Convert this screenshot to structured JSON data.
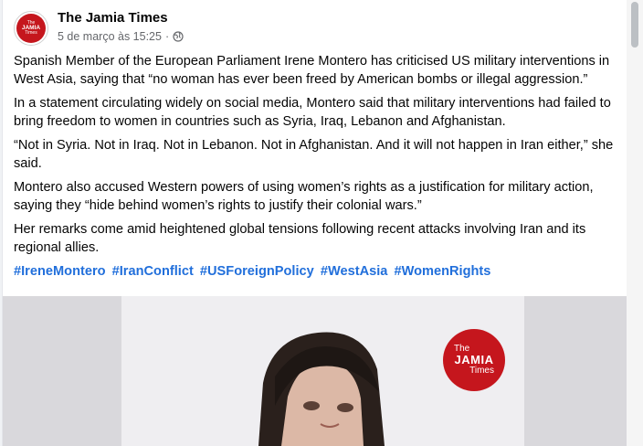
{
  "post": {
    "page_name": "The Jamia Times",
    "avatar": {
      "line1": "The",
      "line2": "JAMIA",
      "line3": "Times"
    },
    "timestamp": "5 de março às 15:25",
    "separator": "·",
    "audience_icon": "globe-icon",
    "paragraphs": [
      "Spanish Member of the European Parliament Irene Montero has criticised US military interventions in West Asia, saying that “no woman has ever been freed by American bombs or illegal aggression.”",
      "In a statement circulating widely on social media, Montero said that military interventions had failed to bring freedom to women in countries such as Syria, Iraq, Lebanon and Afghanistan.",
      "“Not in Syria. Not in Iraq. Not in Lebanon. Not in Afghanistan. And it will not happen in Iran either,” she said.",
      "Montero also accused Western powers of using women’s rights as a justification for military action, saying they “hide behind women’s rights to justify their colonial wars.”",
      "Her remarks come amid heightened global tensions following recent attacks involving Iran and its regional allies."
    ],
    "hashtags": [
      "#IreneMontero",
      "#IranConflict",
      "#USForeignPolicy",
      "#WestAsia",
      "#WomenRights"
    ],
    "watermark": {
      "line1": "The",
      "line2": "JAMIA",
      "line3": "Times"
    }
  },
  "colors": {
    "link": "#216fdb",
    "brand_red": "#c5161d",
    "meta": "#65676b"
  }
}
